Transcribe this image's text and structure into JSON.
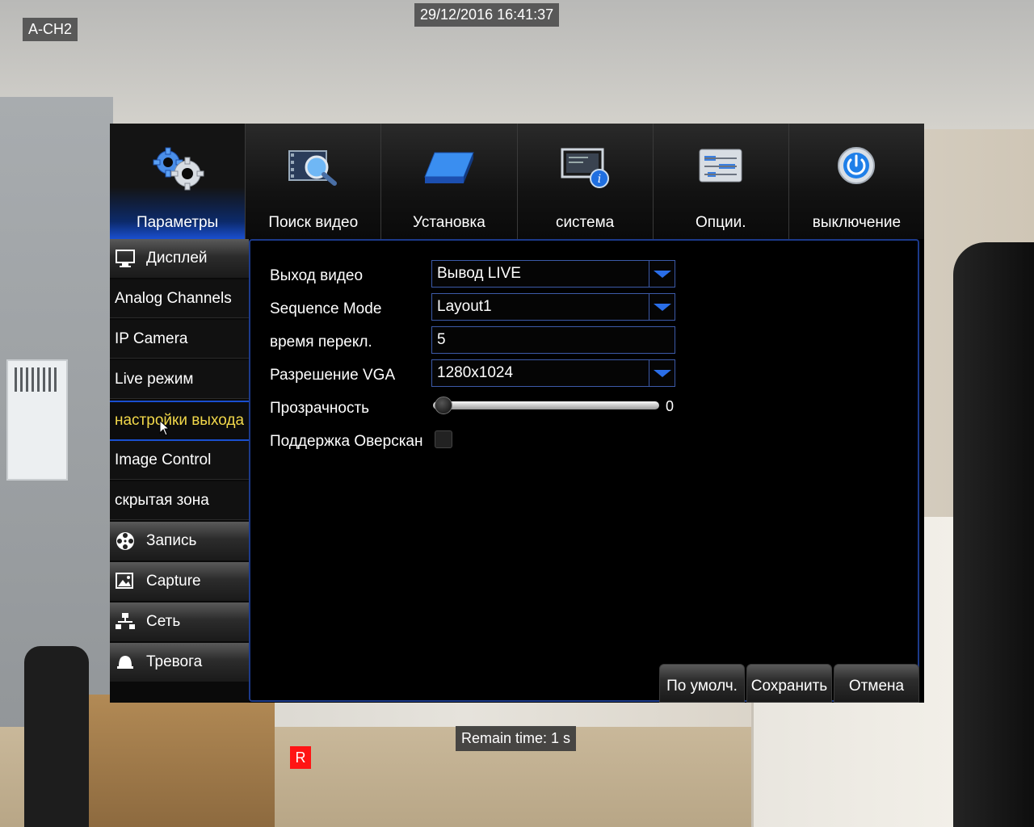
{
  "osd": {
    "channel": "A-CH2",
    "datetime": "29/12/2016 16:41:37",
    "remain_time": "Remain time: 1 s",
    "record_indicator": "R"
  },
  "top_tabs": [
    {
      "label": "Параметры",
      "icon": "gears-icon",
      "active": true
    },
    {
      "label": "Поиск видео",
      "icon": "film-search-icon",
      "active": false
    },
    {
      "label": "Установка",
      "icon": "hard-drive-icon",
      "active": false
    },
    {
      "label": "система",
      "icon": "monitor-info-icon",
      "active": false
    },
    {
      "label": "Опции.",
      "icon": "sliders-icon",
      "active": false
    },
    {
      "label": "выключение",
      "icon": "power-icon",
      "active": false
    }
  ],
  "sidebar": {
    "items": [
      {
        "label": "Дисплей",
        "type": "category",
        "icon": "monitor-icon"
      },
      {
        "label": "Analog Channels",
        "type": "sub"
      },
      {
        "label": "IP Camera",
        "type": "sub"
      },
      {
        "label": "Live режим",
        "type": "sub"
      },
      {
        "label": "настройки выхода",
        "type": "sub",
        "selected": true
      },
      {
        "label": "Image Control",
        "type": "sub"
      },
      {
        "label": "скрытая зона",
        "type": "sub"
      },
      {
        "label": "Запись",
        "type": "category",
        "icon": "film-reel-icon"
      },
      {
        "label": "Capture",
        "type": "category",
        "icon": "picture-icon"
      },
      {
        "label": "Сеть",
        "type": "category",
        "icon": "network-icon"
      },
      {
        "label": "Тревога",
        "type": "category",
        "icon": "alarm-bell-icon"
      }
    ]
  },
  "settings": {
    "video_output": {
      "label": "Выход видео",
      "value": "Вывод LIVE"
    },
    "sequence_mode": {
      "label": "Sequence Mode",
      "value": "Layout1"
    },
    "switch_time": {
      "label": "время перекл.",
      "value": "5"
    },
    "vga_resolution": {
      "label": "Разрешение VGA",
      "value": "1280x1024"
    },
    "transparency": {
      "label": "Прозрачность",
      "value": "0"
    },
    "overscan": {
      "label": "Поддержка Оверскан",
      "checked": false
    }
  },
  "buttons": {
    "default": "По умолч.",
    "save": "Сохранить",
    "cancel": "Отмена"
  },
  "colors": {
    "accent_blue": "#1a4fd0",
    "selected_text": "#f2d84a",
    "record_red": "#ff1414"
  }
}
